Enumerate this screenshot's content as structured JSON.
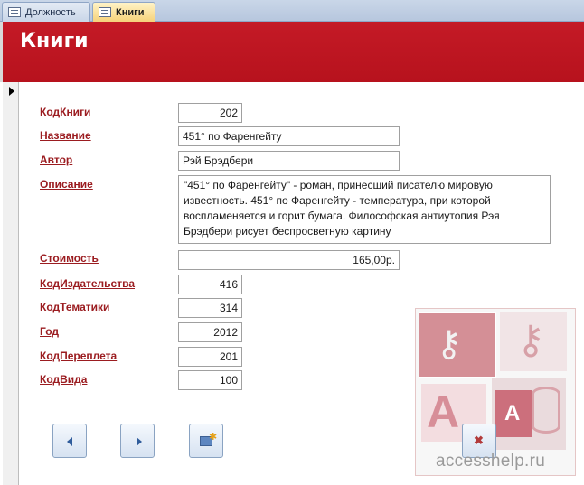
{
  "tabs": [
    {
      "label": "Должность",
      "active": false
    },
    {
      "label": "Книги",
      "active": true
    }
  ],
  "header": {
    "title": "Книги",
    "color": "#c41a26"
  },
  "form": {
    "fields": {
      "kod_knigi": {
        "label": "КодКниги",
        "value": "202"
      },
      "nazvanie": {
        "label": "Название",
        "value": "451° по Фаренгейту"
      },
      "avtor": {
        "label": "Автор",
        "value": "Рэй Брэдбери"
      },
      "opisanie": {
        "label": "Описание",
        "value": "\"451° по Фаренгейту\" - роман, принесший писателю мировую известность. 451° по Фаренгейту - температура, при которой воспламеняется и горит бумага. Философская антиутопия Рэя Брэдбери рисует беспросветную картину"
      },
      "stoimost": {
        "label": "Стоимость",
        "value": "165,00р."
      },
      "kod_izdatelstva": {
        "label": "КодИздательства",
        "value": "416"
      },
      "kod_tematiki": {
        "label": "КодТематики",
        "value": "314"
      },
      "god": {
        "label": "Год",
        "value": "2012"
      },
      "kod_perepleta": {
        "label": "КодПереплета",
        "value": "201"
      },
      "kod_vida": {
        "label": "КодВида",
        "value": "100"
      }
    }
  },
  "nav_buttons": {
    "prev_icon": "arrow-left-icon",
    "next_icon": "arrow-right-icon",
    "new_record_icon": "new-record-icon",
    "close_icon": "close-form-icon"
  },
  "watermark": {
    "text": "accesshelp.ru",
    "letter_a1": "A",
    "letter_a2": "A"
  }
}
